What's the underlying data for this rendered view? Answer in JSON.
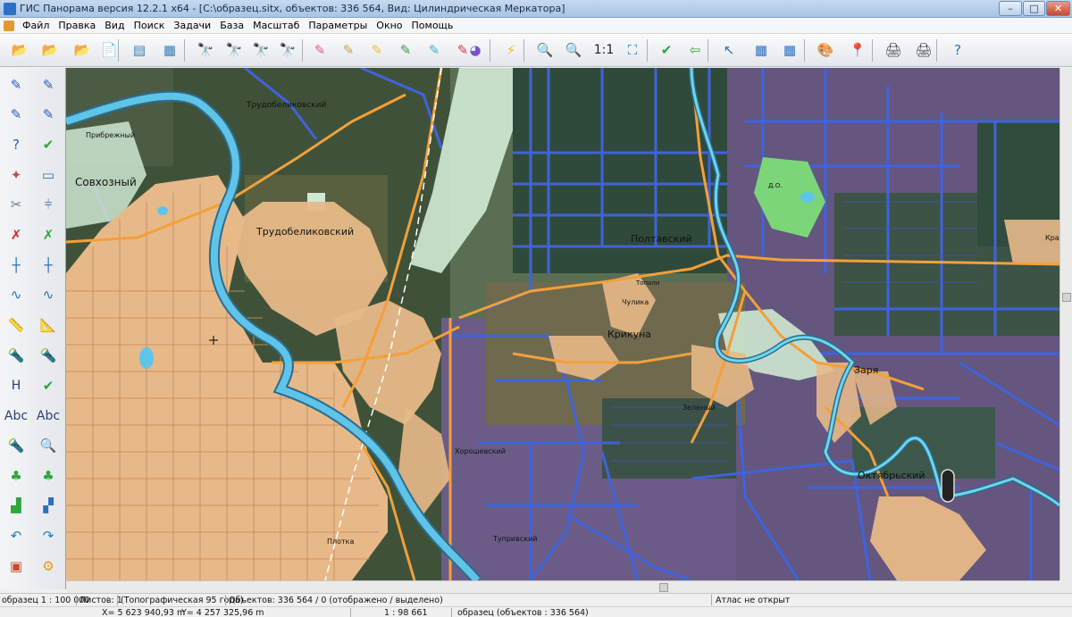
{
  "window": {
    "title": "ГИС Панорама версия 12.2.1 x64 - [C:\\образец.sitx, объектов: 336 564, Вид: Цилиндрическая Меркатора]",
    "minimize_glyph": "–",
    "maximize_glyph": "□",
    "close_glyph": "✕"
  },
  "menu": {
    "items": [
      "Файл",
      "Правка",
      "Вид",
      "Поиск",
      "Задачи",
      "База",
      "Масштаб",
      "Параметры",
      "Окно",
      "Помощь"
    ],
    "mdi_buttons": [
      "–",
      "▫",
      "✕"
    ]
  },
  "toolbar": {
    "buttons": [
      {
        "icon": "open-folder-icon",
        "glyph": "📂"
      },
      {
        "icon": "open-data-icon",
        "glyph": "📂"
      },
      {
        "icon": "open-folder-world-icon",
        "glyph": "📂"
      },
      {
        "icon": "document-info-icon",
        "glyph": "📄"
      },
      {
        "icon": "layers-icon",
        "glyph": "▤"
      },
      {
        "icon": "layer-properties-icon",
        "glyph": "▦"
      },
      {
        "icon": "binoculars-icon",
        "glyph": "🔭"
      },
      {
        "icon": "binoculars-text-icon",
        "glyph": "🔭"
      },
      {
        "icon": "binoculars-more-icon",
        "glyph": "🔭"
      },
      {
        "icon": "binoculars-gray-icon",
        "glyph": "🔭"
      },
      {
        "icon": "highlight-pink-icon",
        "glyph": "✎"
      },
      {
        "icon": "highlight-clear-icon",
        "glyph": "✎"
      },
      {
        "icon": "highlight-yellow-icon",
        "glyph": "✎"
      },
      {
        "icon": "highlight-add-icon",
        "glyph": "✎"
      },
      {
        "icon": "highlight-cyan-icon",
        "glyph": "✎"
      },
      {
        "icon": "highlight-delete-icon",
        "glyph": "✎"
      },
      {
        "icon": "color-palette-icon",
        "glyph": "◕"
      },
      {
        "icon": "lightning-icon",
        "glyph": "⚡"
      },
      {
        "icon": "zoom-out-icon",
        "glyph": "🔍"
      },
      {
        "icon": "zoom-in-icon",
        "glyph": "🔍"
      },
      {
        "icon": "scale-1-1-icon",
        "label": "1:1"
      },
      {
        "icon": "zoom-extent-icon",
        "glyph": "⛶"
      },
      {
        "icon": "checkmark-icon",
        "glyph": "✔"
      },
      {
        "icon": "back-arrow-icon",
        "glyph": "⇦"
      },
      {
        "icon": "pointer-icon",
        "glyph": "↖"
      },
      {
        "icon": "table-select-icon",
        "glyph": "▦"
      },
      {
        "icon": "table-text-icon",
        "glyph": "▦"
      },
      {
        "icon": "paint-icon",
        "glyph": "🎨"
      },
      {
        "icon": "route-pin-icon",
        "glyph": "📍"
      },
      {
        "icon": "print-icon",
        "glyph": "🖨"
      },
      {
        "icon": "print-preview-icon",
        "glyph": "🖨"
      },
      {
        "icon": "help-pointer-icon",
        "glyph": "?"
      }
    ]
  },
  "left_toolbar": {
    "buttons": [
      {
        "icon": "draw-line-icon",
        "glyph": "✎"
      },
      {
        "icon": "draw-line-edit-icon",
        "glyph": "✎"
      },
      {
        "icon": "draw-points-icon",
        "glyph": "✎"
      },
      {
        "icon": "draw-polyline-icon",
        "glyph": "✎"
      },
      {
        "icon": "help-draw-icon",
        "glyph": "?"
      },
      {
        "icon": "check-draw-icon",
        "glyph": "✔"
      },
      {
        "icon": "compass-icon",
        "glyph": "✦"
      },
      {
        "icon": "rectangle-select-icon",
        "glyph": "▭"
      },
      {
        "icon": "scissors-icon",
        "glyph": "✂"
      },
      {
        "icon": "split-icon",
        "glyph": "⫩"
      },
      {
        "icon": "delete-x-icon",
        "glyph": "✗"
      },
      {
        "icon": "delete-object-icon",
        "glyph": "✗"
      },
      {
        "icon": "vertex-line-icon",
        "glyph": "┼"
      },
      {
        "icon": "vertex-branch-icon",
        "glyph": "┼"
      },
      {
        "icon": "curve-icon",
        "glyph": "∿"
      },
      {
        "icon": "curve-node-icon",
        "glyph": "∿"
      },
      {
        "icon": "ruler-icon",
        "glyph": "📏"
      },
      {
        "icon": "measure-icon",
        "glyph": "📐"
      },
      {
        "icon": "flashlight-text-icon",
        "glyph": "🔦"
      },
      {
        "icon": "flashlight-grid-icon",
        "glyph": "🔦"
      },
      {
        "icon": "height-icon",
        "label": "H"
      },
      {
        "icon": "check-bracket-icon",
        "glyph": "✔"
      },
      {
        "icon": "text-label-icon",
        "label": "Abc"
      },
      {
        "icon": "text-edit-icon",
        "label": "Abc"
      },
      {
        "icon": "flashlight-icon",
        "glyph": "🔦"
      },
      {
        "icon": "zoom-search-icon",
        "glyph": "🔍"
      },
      {
        "icon": "tree-icon",
        "glyph": "♣"
      },
      {
        "icon": "tree-check-icon",
        "glyph": "♣"
      },
      {
        "icon": "stairs-icon",
        "glyph": "▟"
      },
      {
        "icon": "transform-icon",
        "glyph": "▞"
      },
      {
        "icon": "undo-arrow-icon",
        "glyph": "↶"
      },
      {
        "icon": "redo-arrow-icon",
        "glyph": "↷"
      },
      {
        "icon": "image-icon",
        "glyph": "▣"
      },
      {
        "icon": "gear-icon",
        "glyph": "⚙"
      }
    ]
  },
  "map": {
    "labels": [
      "Трудобеликовский",
      "Прибрежный",
      "Совхозный",
      "Трудобеликовский",
      "Полтавский",
      "Крикуна",
      "Чулика",
      "Заря",
      "Октябрьский",
      "Зеленый",
      "Хорошевский",
      "Тупривский",
      "Плотка",
      "Д.О.",
      "Тополи",
      "Кра"
    ]
  },
  "status": {
    "scale": "образец  1 : 100 000",
    "sheets": "Листов: 1",
    "classifier": "(Топографическая 95 года)",
    "objects": "Объектов: 336 564 / 0 (отображено / выделено)",
    "atlas": "Атлас не открыт",
    "x_coord": "X= 5 623 940,93  m",
    "y_coord": "Y= 4 257 325,96  m",
    "current_scale": "1 : 98 661",
    "map_info": "образец   (объектов : 336 564)"
  },
  "colors": {
    "titlebar": "#b3cdeb",
    "map_background": "#3d4f3a",
    "settlement": "#e8b988",
    "river": "#5fc4e8",
    "road": "#f3a03a",
    "parcel_border": "#3b5fd8",
    "field_purple": "#6b5a8a",
    "green_field": "#7bd67a",
    "light_zone": "#cfe8d2"
  }
}
